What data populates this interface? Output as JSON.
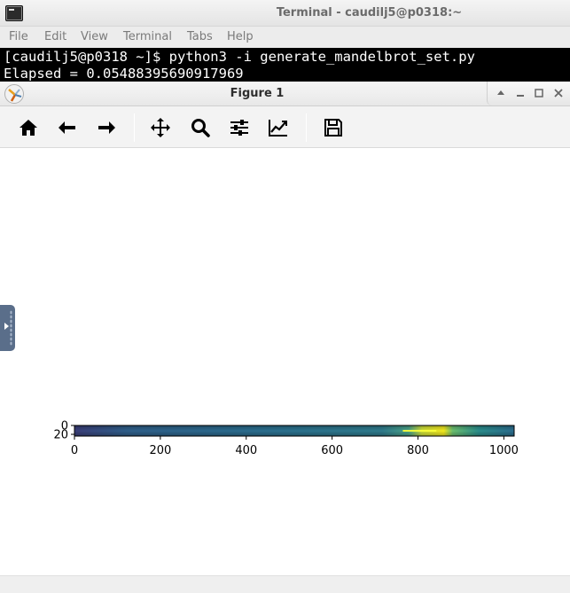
{
  "terminal": {
    "title": "Terminal - caudilj5@p0318:~",
    "menu": [
      "File",
      "Edit",
      "View",
      "Terminal",
      "Tabs",
      "Help"
    ],
    "lines": [
      "[caudilj5@p0318 ~]$ python3 -i generate_mandelbrot_set.py",
      "Elapsed = 0.05488395690917969"
    ]
  },
  "figure": {
    "title": "Figure 1",
    "window_buttons": [
      "up-icon",
      "minimize-icon",
      "maximize-icon",
      "close-icon"
    ],
    "toolbar": [
      {
        "name": "home-button",
        "icon": "home-icon"
      },
      {
        "name": "back-button",
        "icon": "arrow-left-icon"
      },
      {
        "name": "forward-button",
        "icon": "arrow-right-icon"
      },
      {
        "name": "pan-button",
        "icon": "move-icon"
      },
      {
        "name": "zoom-button",
        "icon": "magnifier-icon"
      },
      {
        "name": "subplots-button",
        "icon": "sliders-icon"
      },
      {
        "name": "customize-button",
        "icon": "line-chart-icon"
      },
      {
        "name": "save-button",
        "icon": "floppy-disk-icon"
      }
    ]
  },
  "chart_data": {
    "type": "heatmap",
    "colormap": "viridis",
    "x_ticks": [
      0,
      200,
      400,
      600,
      800,
      1000
    ],
    "x_tick_labels": [
      "0",
      "200",
      "400",
      "600",
      "800",
      "1000"
    ],
    "y_ticks": [
      0,
      20
    ],
    "y_tick_labels": [
      "0",
      "20"
    ],
    "xlim": [
      0,
      1024
    ],
    "ylim": [
      24,
      0
    ],
    "bright_region_x": [
      740,
      880
    ]
  }
}
